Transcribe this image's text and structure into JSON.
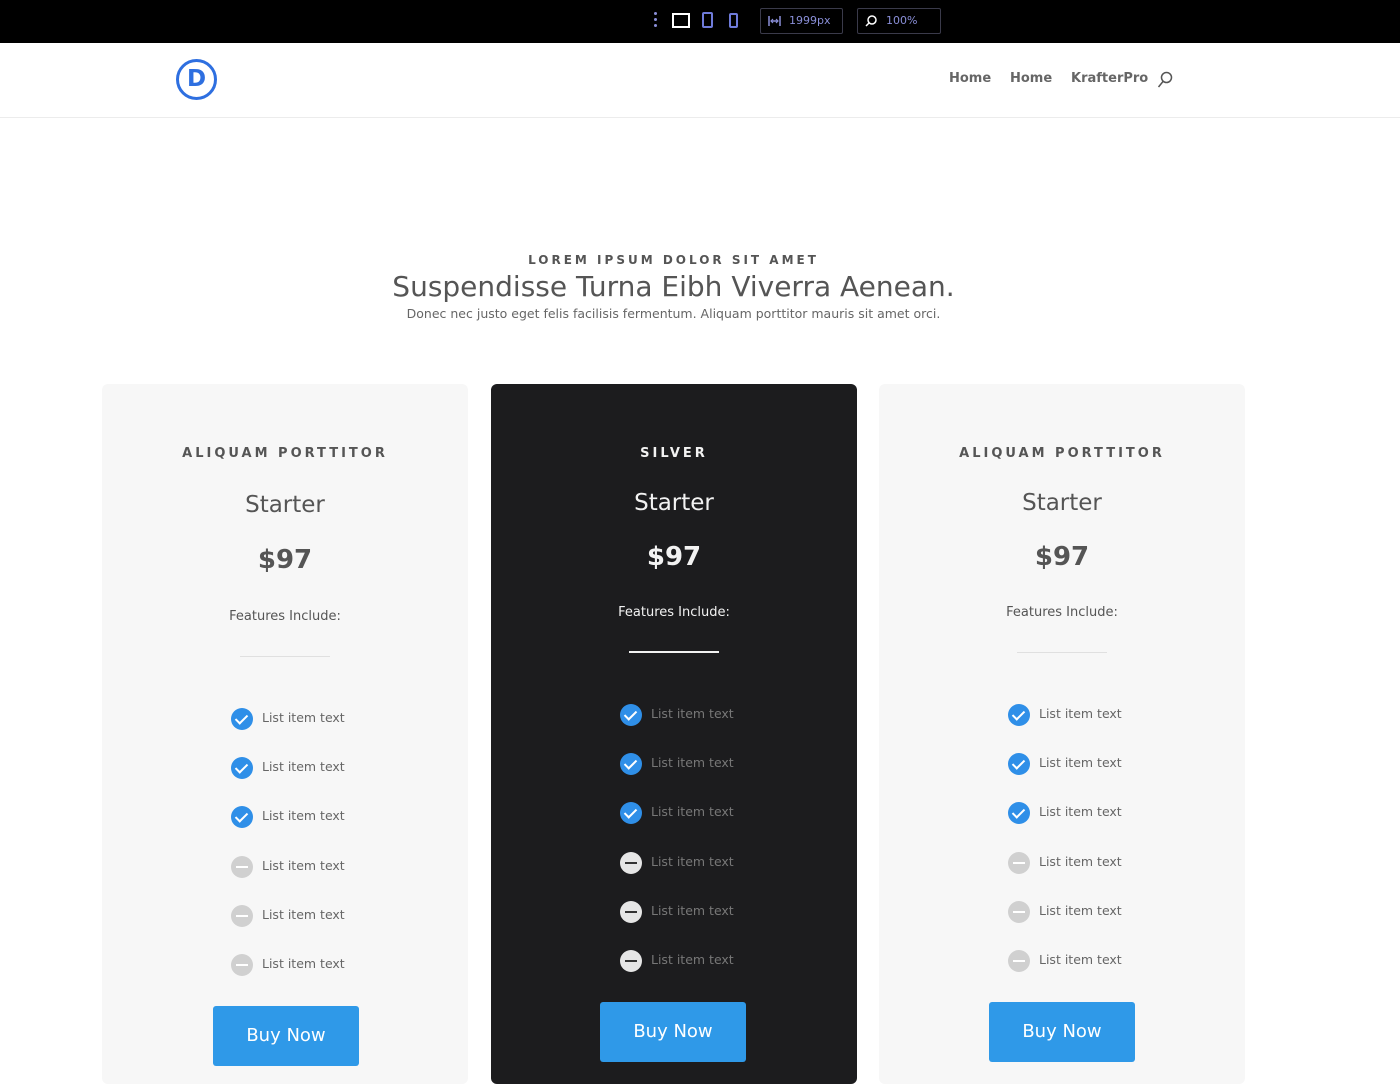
{
  "toolbar": {
    "width_value": "1999px",
    "zoom_value": "100%"
  },
  "header": {
    "logo_letter": "D",
    "nav": [
      "Home",
      "Home",
      "KrafterPro"
    ]
  },
  "intro": {
    "eyebrow": "LOREM IPSUM DOLOR SIT AMET",
    "headline": "Suspendisse Turna Eibh Viverra Aenean.",
    "subtext": "Donec nec justo eget felis facilisis fermentum. Aliquam porttitor mauris sit amet orci."
  },
  "cards": [
    {
      "label": "ALIQUAM PORTTITOR",
      "title": "Starter",
      "price": "$97",
      "features_heading": "Features Include:",
      "items": [
        {
          "text": "List item text",
          "icon": "check-circle-icon"
        },
        {
          "text": "List item text",
          "icon": "check-circle-icon"
        },
        {
          "text": "List item text",
          "icon": "check-circle-icon"
        },
        {
          "text": "List item text",
          "icon": "minus-circle-icon"
        },
        {
          "text": "List item text",
          "icon": "minus-circle-icon"
        },
        {
          "text": "List item text",
          "icon": "minus-circle-icon"
        }
      ],
      "button": "Buy Now"
    },
    {
      "label": "SILVER",
      "title": "Starter",
      "price": "$97",
      "features_heading": "Features Include:",
      "items": [
        {
          "text": "List item text",
          "icon": "check-circle-icon"
        },
        {
          "text": "List item text",
          "icon": "check-circle-icon"
        },
        {
          "text": "List item text",
          "icon": "check-circle-icon"
        },
        {
          "text": "List item text",
          "icon": "minus-circle-icon"
        },
        {
          "text": "List item text",
          "icon": "minus-circle-icon"
        },
        {
          "text": "List item text",
          "icon": "minus-circle-icon"
        }
      ],
      "button": "Buy Now"
    },
    {
      "label": "ALIQUAM PORTTITOR",
      "title": "Starter",
      "price": "$97",
      "features_heading": "Features Include:",
      "items": [
        {
          "text": "List item text",
          "icon": "check-circle-icon"
        },
        {
          "text": "List item text",
          "icon": "check-circle-icon"
        },
        {
          "text": "List item text",
          "icon": "check-circle-icon"
        },
        {
          "text": "List item text",
          "icon": "minus-circle-icon"
        },
        {
          "text": "List item text",
          "icon": "minus-circle-icon"
        },
        {
          "text": "List item text",
          "icon": "minus-circle-icon"
        }
      ],
      "button": "Buy Now"
    }
  ],
  "colors": {
    "accent_blue": "#2f99e8",
    "check_blue": "#2f8fe8",
    "logo_blue": "#2e6fe0",
    "dark_card": "#1c1c1e",
    "light_card": "#f7f7f7"
  }
}
